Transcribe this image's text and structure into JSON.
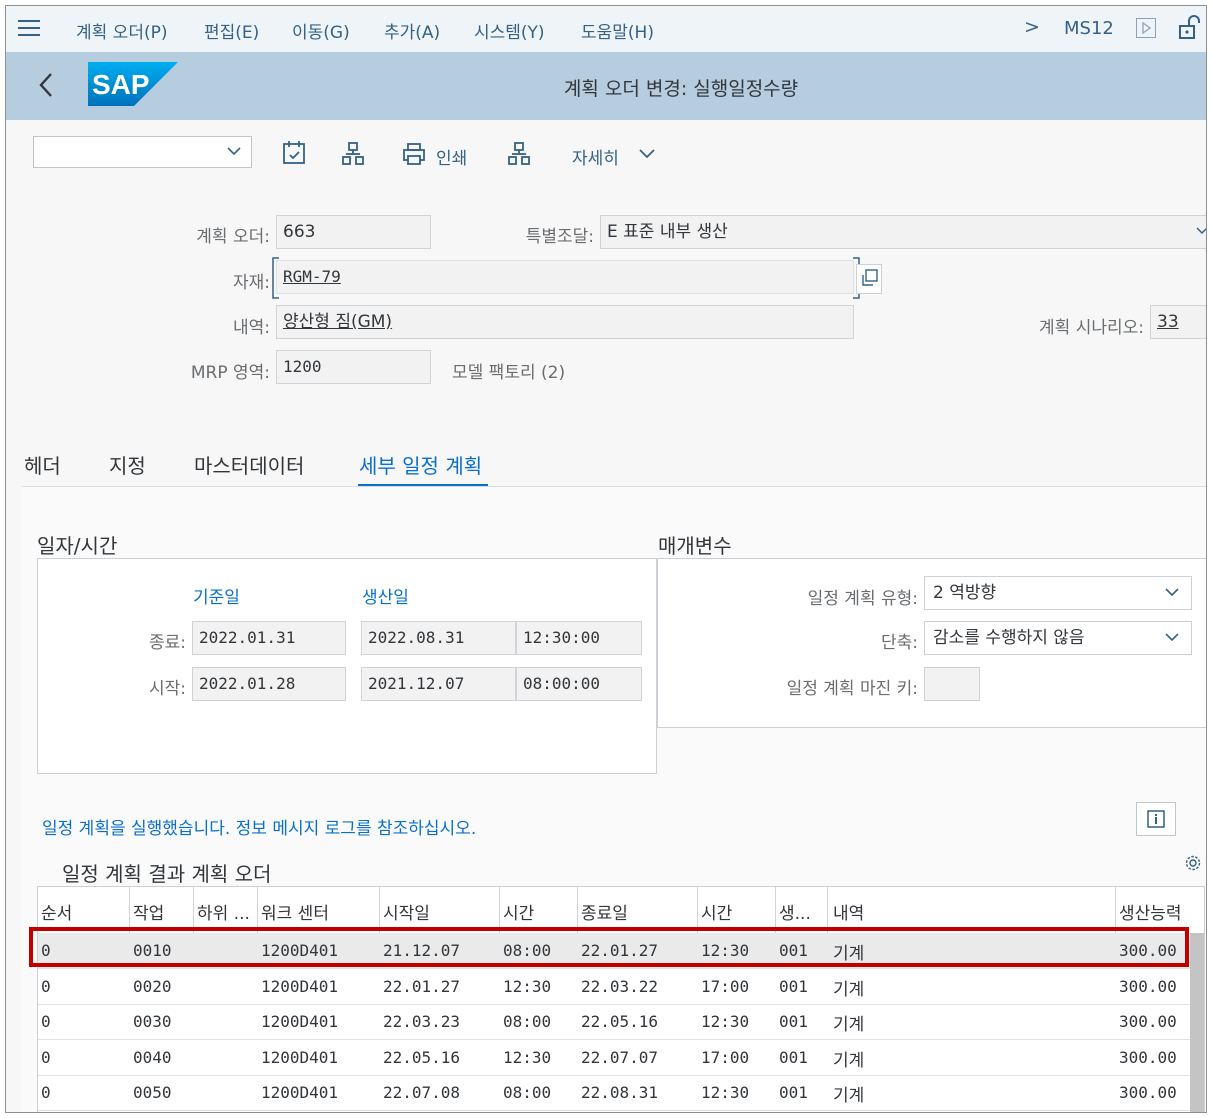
{
  "menu": {
    "items": [
      "계획 오더(P)",
      "편집(E)",
      "이동(G)",
      "추가(A)",
      "시스템(Y)",
      "도움말(H)"
    ],
    "transaction": "MS12",
    "more_glyph": ">"
  },
  "header": {
    "title": "계획 오더 변경: 실행일정수량",
    "logo_text": "SAP"
  },
  "toolbar": {
    "dropdown_value": "",
    "print_label": "인쇄",
    "more_label": "자세히"
  },
  "form": {
    "planned_order_label": "계획 오더:",
    "planned_order": "663",
    "special_proc_label": "특별조달:",
    "special_proc": "E 표준 내부 생산",
    "material_label": "자재:",
    "material": "RGM-79",
    "desc_label": "내역:",
    "desc": "양산형 짐(GM)",
    "scenario_label": "계획 시나리오:",
    "scenario": "33",
    "mrp_label": "MRP 영역:",
    "mrp": "1200",
    "mrp_text": "모델 팩토리 (2)"
  },
  "tabs": [
    {
      "label": "헤더"
    },
    {
      "label": "지정"
    },
    {
      "label": "마스터데이터"
    },
    {
      "label": "세부 일정 계획"
    }
  ],
  "dates": {
    "section_title": "일자/시간",
    "basic_head": "기준일",
    "prod_head": "생산일",
    "end_label": "종료:",
    "start_label": "시작:",
    "basic_end": "2022.01.31",
    "basic_start": "2022.01.28",
    "prod_end": "2022.08.31",
    "prod_end_time": "12:30:00",
    "prod_start": "2021.12.07",
    "prod_start_time": "08:00:00"
  },
  "params": {
    "section_title": "매개변수",
    "type_label": "일정 계획 유형:",
    "type_value": "2 역방향",
    "reduce_label": "단축:",
    "reduce_value": "감소를 수행하지 않음",
    "margin_label": "일정 계획 마진 키:",
    "margin_value": ""
  },
  "message": "일정 계획을 실행했습니다. 정보 메시지 로그를 참조하십시오.",
  "table": {
    "title": "일정 계획 결과 계획 오더",
    "columns": [
      "순서",
      "작업",
      "하위 ...",
      "워크 센터",
      "시작일",
      "시간",
      "종료일",
      "시간",
      "생...",
      "내역",
      "생산능력"
    ],
    "rows": [
      [
        "0",
        "0010",
        "",
        "1200D401",
        "21.12.07",
        "08:00",
        "22.01.27",
        "12:30",
        "001",
        "기계",
        "300.00"
      ],
      [
        "0",
        "0020",
        "",
        "1200D401",
        "22.01.27",
        "12:30",
        "22.03.22",
        "17:00",
        "001",
        "기계",
        "300.00"
      ],
      [
        "0",
        "0030",
        "",
        "1200D401",
        "22.03.23",
        "08:00",
        "22.05.16",
        "12:30",
        "001",
        "기계",
        "300.00"
      ],
      [
        "0",
        "0040",
        "",
        "1200D401",
        "22.05.16",
        "12:30",
        "22.07.07",
        "17:00",
        "001",
        "기계",
        "300.00"
      ],
      [
        "0",
        "0050",
        "",
        "1200D401",
        "22.07.08",
        "08:00",
        "22.08.31",
        "12:30",
        "001",
        "기계",
        "300.00"
      ]
    ]
  },
  "colors": {
    "accent": "#0a6ed1",
    "shell": "#b6cde0",
    "highlight": "#c00000"
  }
}
